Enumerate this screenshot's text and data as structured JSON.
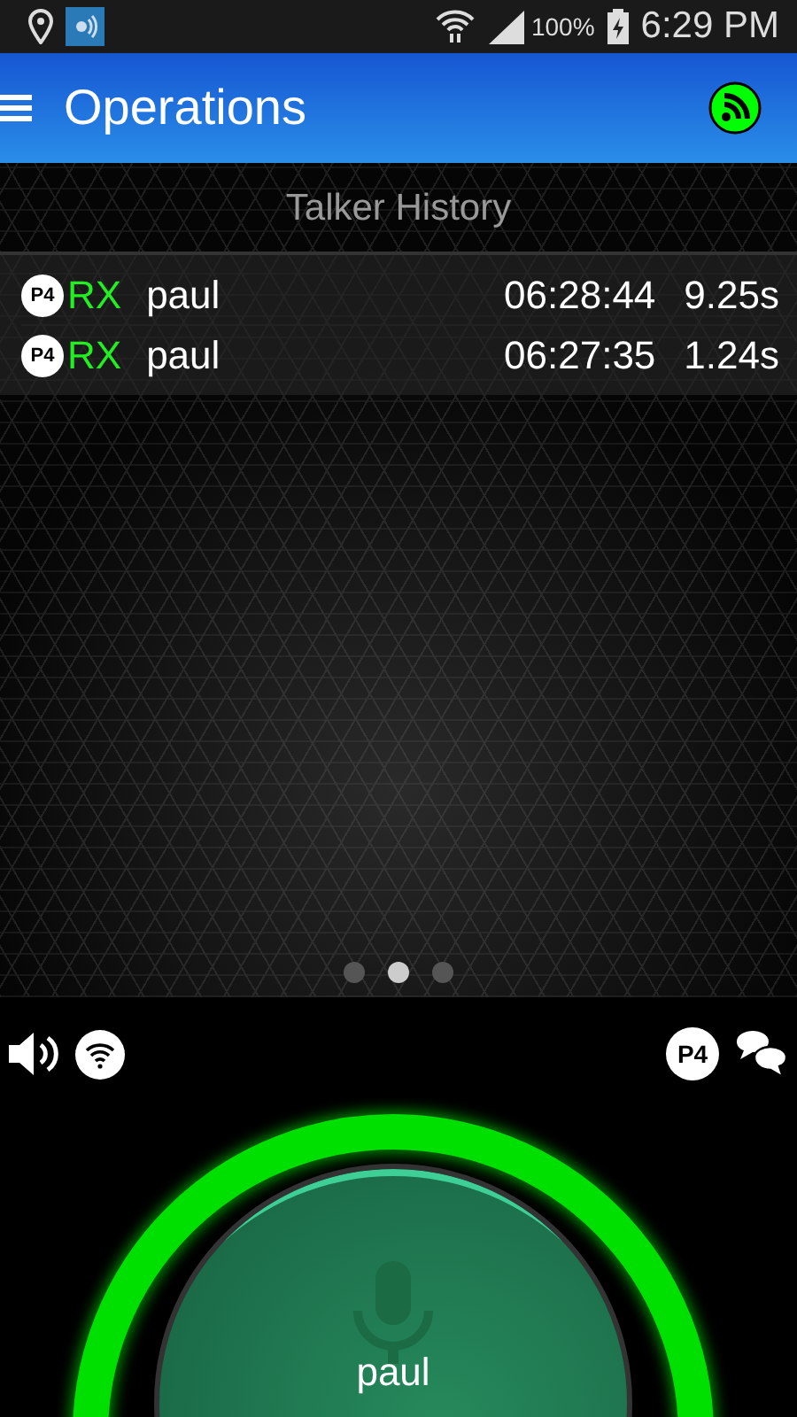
{
  "status_bar": {
    "battery": "100%",
    "time": "6:29 PM"
  },
  "app_bar": {
    "title": "Operations"
  },
  "talker_history": {
    "title": "Talker History",
    "rows": [
      {
        "badge": "P4",
        "direction": "RX",
        "name": "paul",
        "time": "06:28:44",
        "duration": "9.25s"
      },
      {
        "badge": "P4",
        "direction": "RX",
        "name": "paul",
        "time": "06:27:35",
        "duration": "1.24s"
      }
    ]
  },
  "pager_dots": [
    {
      "selected": false
    },
    {
      "selected": true
    },
    {
      "selected": false
    }
  ],
  "controls": {
    "channel_badge": "P4"
  },
  "talk_button": {
    "name": "paul"
  }
}
